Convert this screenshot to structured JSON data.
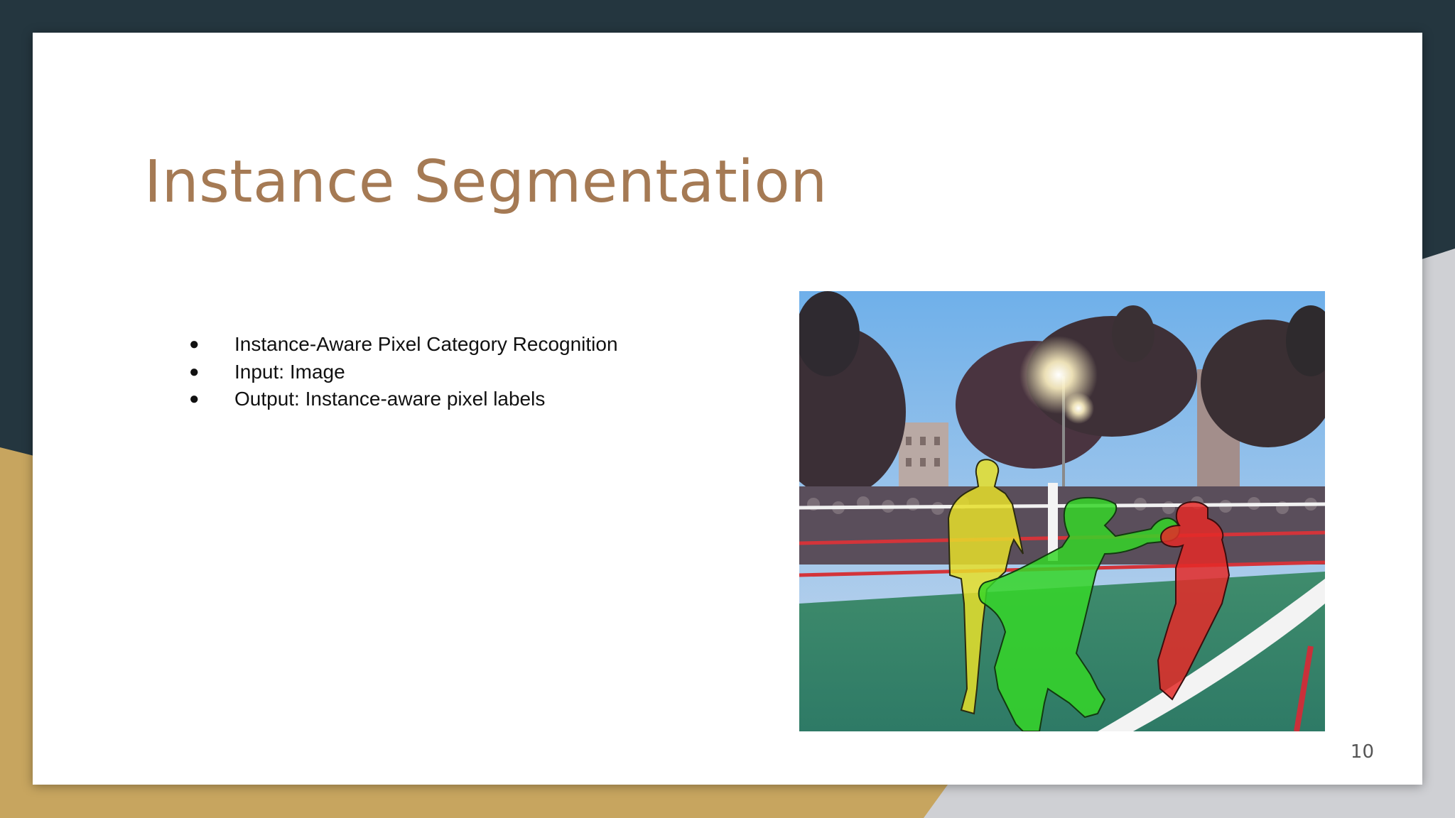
{
  "slide": {
    "title": "Instance Segmentation",
    "bullets": [
      "Instance-Aware Pixel Category Recognition",
      "Input: Image",
      "Output: Instance-aware pixel labels"
    ],
    "page_number": "10"
  },
  "figure": {
    "subject": "boxing-ring-photo",
    "instance_mask_colors": [
      "#e6df2a",
      "#35d628",
      "#e42a28"
    ]
  },
  "colors": {
    "title": "#a57a54",
    "theme_dark": "#24363f",
    "theme_gold": "#c7a55f",
    "theme_gray": "#cfd0d4",
    "background": "#ffffff"
  }
}
